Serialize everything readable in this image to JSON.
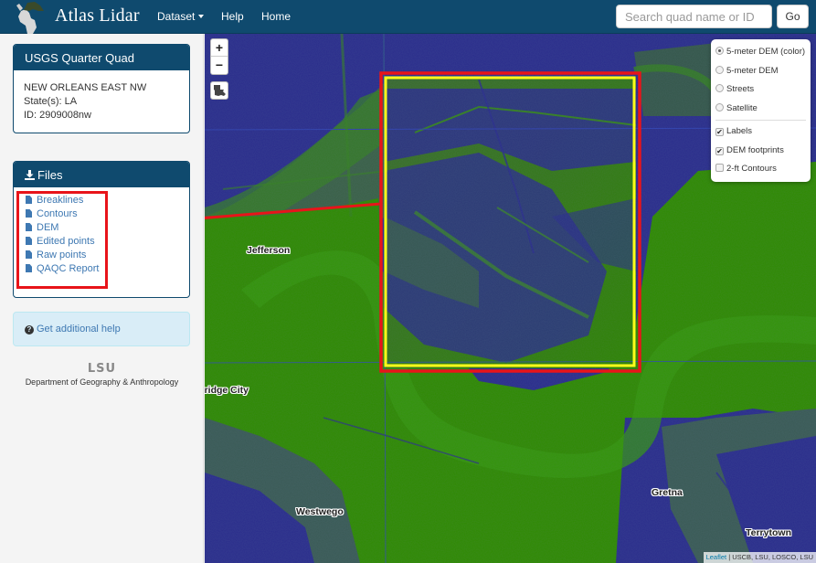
{
  "app": {
    "title": "Atlas Lidar",
    "nav": [
      {
        "label": "Dataset",
        "has_dropdown": true
      },
      {
        "label": "Help"
      },
      {
        "label": "Home"
      }
    ],
    "search": {
      "placeholder": "Search quad name or ID",
      "value": "",
      "button_label": "Go"
    }
  },
  "sidebar": {
    "quad_panel": {
      "title": "USGS Quarter Quad",
      "name": "NEW ORLEANS EAST NW",
      "states": "State(s): LA",
      "id": "ID: 2909008nw"
    },
    "files_panel": {
      "title": "Files",
      "icon": "download-icon",
      "items": [
        {
          "label": "Breaklines",
          "icon": "file-icon"
        },
        {
          "label": "Contours",
          "icon": "file-icon"
        },
        {
          "label": "DEM",
          "icon": "file-icon"
        },
        {
          "label": "Edited points",
          "icon": "file-icon"
        },
        {
          "label": "Raw points",
          "icon": "file-icon"
        },
        {
          "label": "QAQC Report",
          "icon": "file-icon"
        }
      ]
    },
    "help": {
      "label": "Get additional help",
      "icon": "question-circle-icon"
    },
    "footer": {
      "logo_text": "LSU",
      "department": "Department of Geography & Anthropology"
    }
  },
  "map": {
    "zoom_in": "+",
    "zoom_out": "−",
    "home_icon": "louisiana-state-icon",
    "layers": {
      "base": [
        {
          "label": "5-meter DEM (color)",
          "selected": true
        },
        {
          "label": "5-meter DEM",
          "selected": false
        },
        {
          "label": "Streets",
          "selected": false
        },
        {
          "label": "Satellite",
          "selected": false
        }
      ],
      "overlays": [
        {
          "label": "Labels",
          "checked": true
        },
        {
          "label": "DEM footprints",
          "checked": true
        },
        {
          "label": "2-ft Contours",
          "checked": false
        }
      ]
    },
    "places": [
      "Jefferson",
      "Bridge City",
      "Westwego",
      "Gretna",
      "Terrytown"
    ],
    "attribution": {
      "link": "Leaflet",
      "text": "| USCB, LSU, LOSCO, LSU"
    },
    "colors": {
      "low": "#2a2c8c",
      "high": "#2e8f00",
      "footprint": "#ffff1a",
      "highlight": "#e8141a"
    }
  }
}
